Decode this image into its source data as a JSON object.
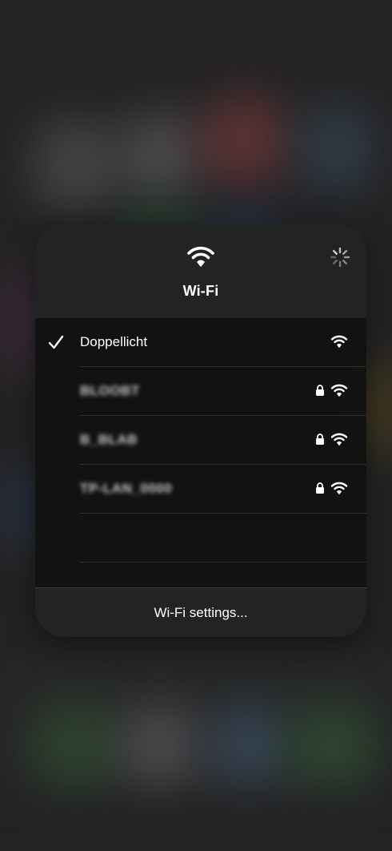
{
  "panel": {
    "title": "Wi-Fi",
    "header_icon": "wifi-icon",
    "status_icon": "loading-spinner-icon"
  },
  "networks": [
    {
      "name": "Doppellicht",
      "connected": true,
      "locked": false
    },
    {
      "name": "BLOOBT",
      "connected": false,
      "locked": true,
      "obscured": true
    },
    {
      "name": "B_BLAB",
      "connected": false,
      "locked": true,
      "obscured": true
    },
    {
      "name": "TP-LAN_0000",
      "connected": false,
      "locked": true,
      "obscured": true
    }
  ],
  "footer": {
    "settings_label": "Wi-Fi settings..."
  },
  "colors": {
    "text": "#ffffff",
    "panel_bg": "#1c1c1c"
  }
}
